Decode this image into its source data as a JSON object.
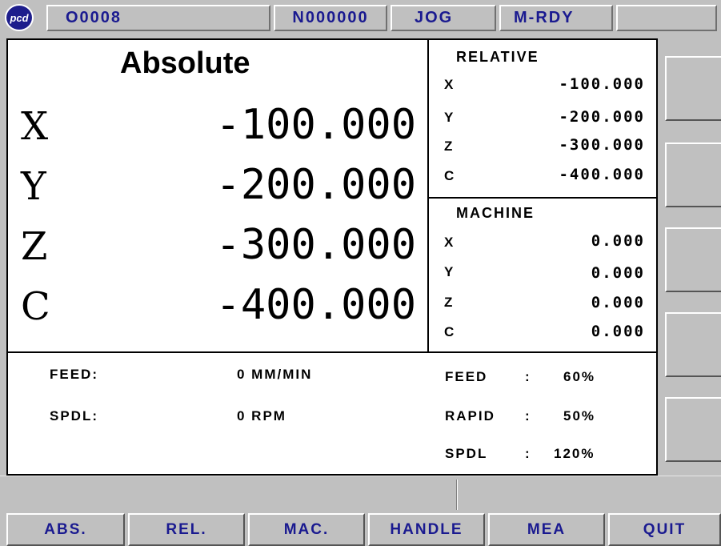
{
  "header": {
    "logo_text": "pcd",
    "program": "O0008",
    "sequence": "N000000",
    "mode": "JOG",
    "status": "M-RDY",
    "extra": ""
  },
  "absolute": {
    "title": "Absolute",
    "rows": [
      {
        "axis": "X",
        "value": "-100.000"
      },
      {
        "axis": "Y",
        "value": "-200.000"
      },
      {
        "axis": "Z",
        "value": "-300.000"
      },
      {
        "axis": "C",
        "value": "-400.000"
      }
    ]
  },
  "relative": {
    "title": "RELATIVE",
    "rows": [
      {
        "axis": "X",
        "value": "-100.000"
      },
      {
        "axis": "Y",
        "value": "-200.000"
      },
      {
        "axis": "Z",
        "value": "-300.000"
      },
      {
        "axis": "C",
        "value": "-400.000"
      }
    ]
  },
  "machine": {
    "title": "MACHINE",
    "rows": [
      {
        "axis": "X",
        "value": "0.000"
      },
      {
        "axis": "Y",
        "value": "0.000"
      },
      {
        "axis": "Z",
        "value": "0.000"
      },
      {
        "axis": "C",
        "value": "0.000"
      }
    ]
  },
  "info": {
    "feed_label": "FEED:",
    "feed_value": "0 MM/MIN",
    "spdl_label": "SPDL:",
    "spdl_value": "0 RPM",
    "overrides": [
      {
        "label": "FEED",
        "sep": ":",
        "value": "60%"
      },
      {
        "label": "RAPID",
        "sep": ":",
        "value": "50%"
      },
      {
        "label": "SPDL",
        "sep": ":",
        "value": "120%"
      }
    ]
  },
  "message": "",
  "softkeys": [
    "ABS.",
    "REL.",
    "MAC.",
    "HANDLE",
    "MEA",
    "QUIT"
  ]
}
